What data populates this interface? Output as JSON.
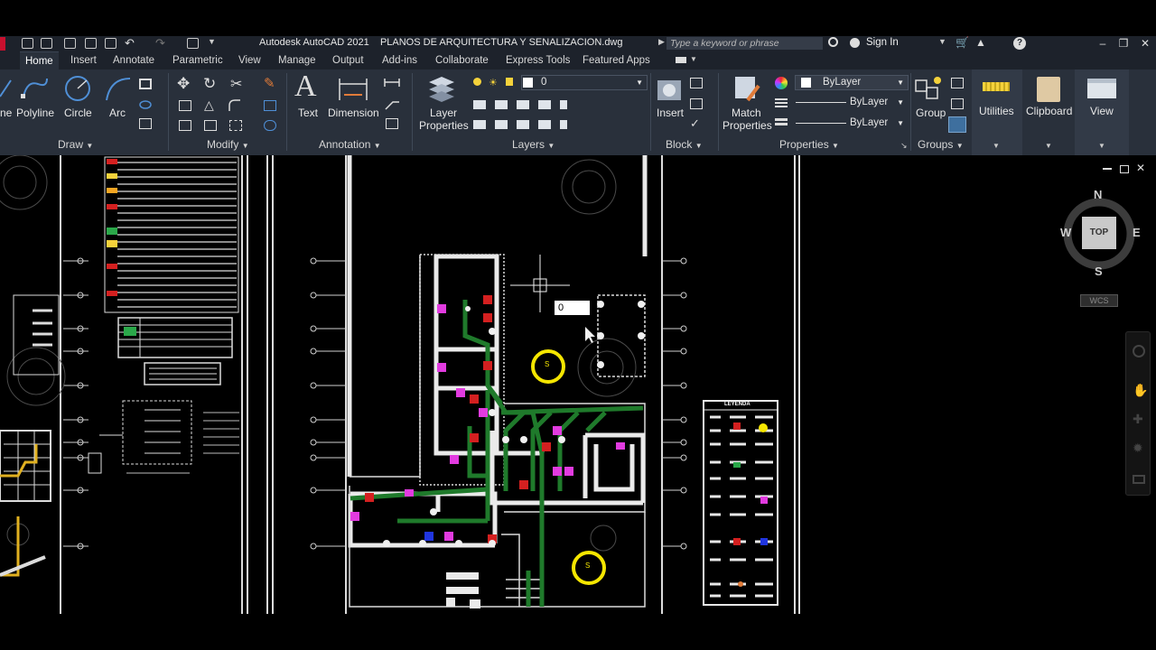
{
  "app": {
    "title": "Autodesk AutoCAD 2021",
    "document": "PLANOS DE ARQUITECTURA Y SENALIZACION.dwg",
    "search_placeholder": "Type a keyword or phrase",
    "sign_in": "Sign In"
  },
  "tabs": [
    "Home",
    "Insert",
    "Annotate",
    "Parametric",
    "View",
    "Manage",
    "Output",
    "Add-ins",
    "Collaborate",
    "Express Tools",
    "Featured Apps"
  ],
  "ribbon": {
    "draw": {
      "line": "ne",
      "polyline": "Polyline",
      "circle": "Circle",
      "arc": "Arc",
      "title": "Draw"
    },
    "modify": {
      "title": "Modify"
    },
    "annotation": {
      "text": "Text",
      "dimension": "Dimension",
      "title": "Annotation"
    },
    "layers": {
      "layer_properties_1": "Layer",
      "layer_properties_2": "Properties",
      "current_layer": "0",
      "title": "Layers"
    },
    "block": {
      "insert": "Insert",
      "title": "Block"
    },
    "properties": {
      "match_1": "Match",
      "match_2": "Properties",
      "color": "ByLayer",
      "linetype": "ByLayer",
      "lineweight": "ByLayer",
      "title": "Properties"
    },
    "groups": {
      "group": "Group",
      "title": "Groups"
    },
    "utilities": "Utilities",
    "clipboard": "Clipboard",
    "view": "View"
  },
  "viewcube": {
    "n": "N",
    "s": "S",
    "e": "E",
    "w": "W",
    "top": "TOP",
    "wcs": "WCS"
  },
  "drawing": {
    "input_value": "0",
    "legend_title": "LEYENDA",
    "sign_label": "S"
  },
  "colors": {
    "ribbon_bg": "#29303b",
    "tab_bg": "#1d222b",
    "accent": "#4f8fd6",
    "pipe_green": "#1f7a2b",
    "marker_yellow": "#f5e600",
    "magenta": "#e23be0"
  }
}
